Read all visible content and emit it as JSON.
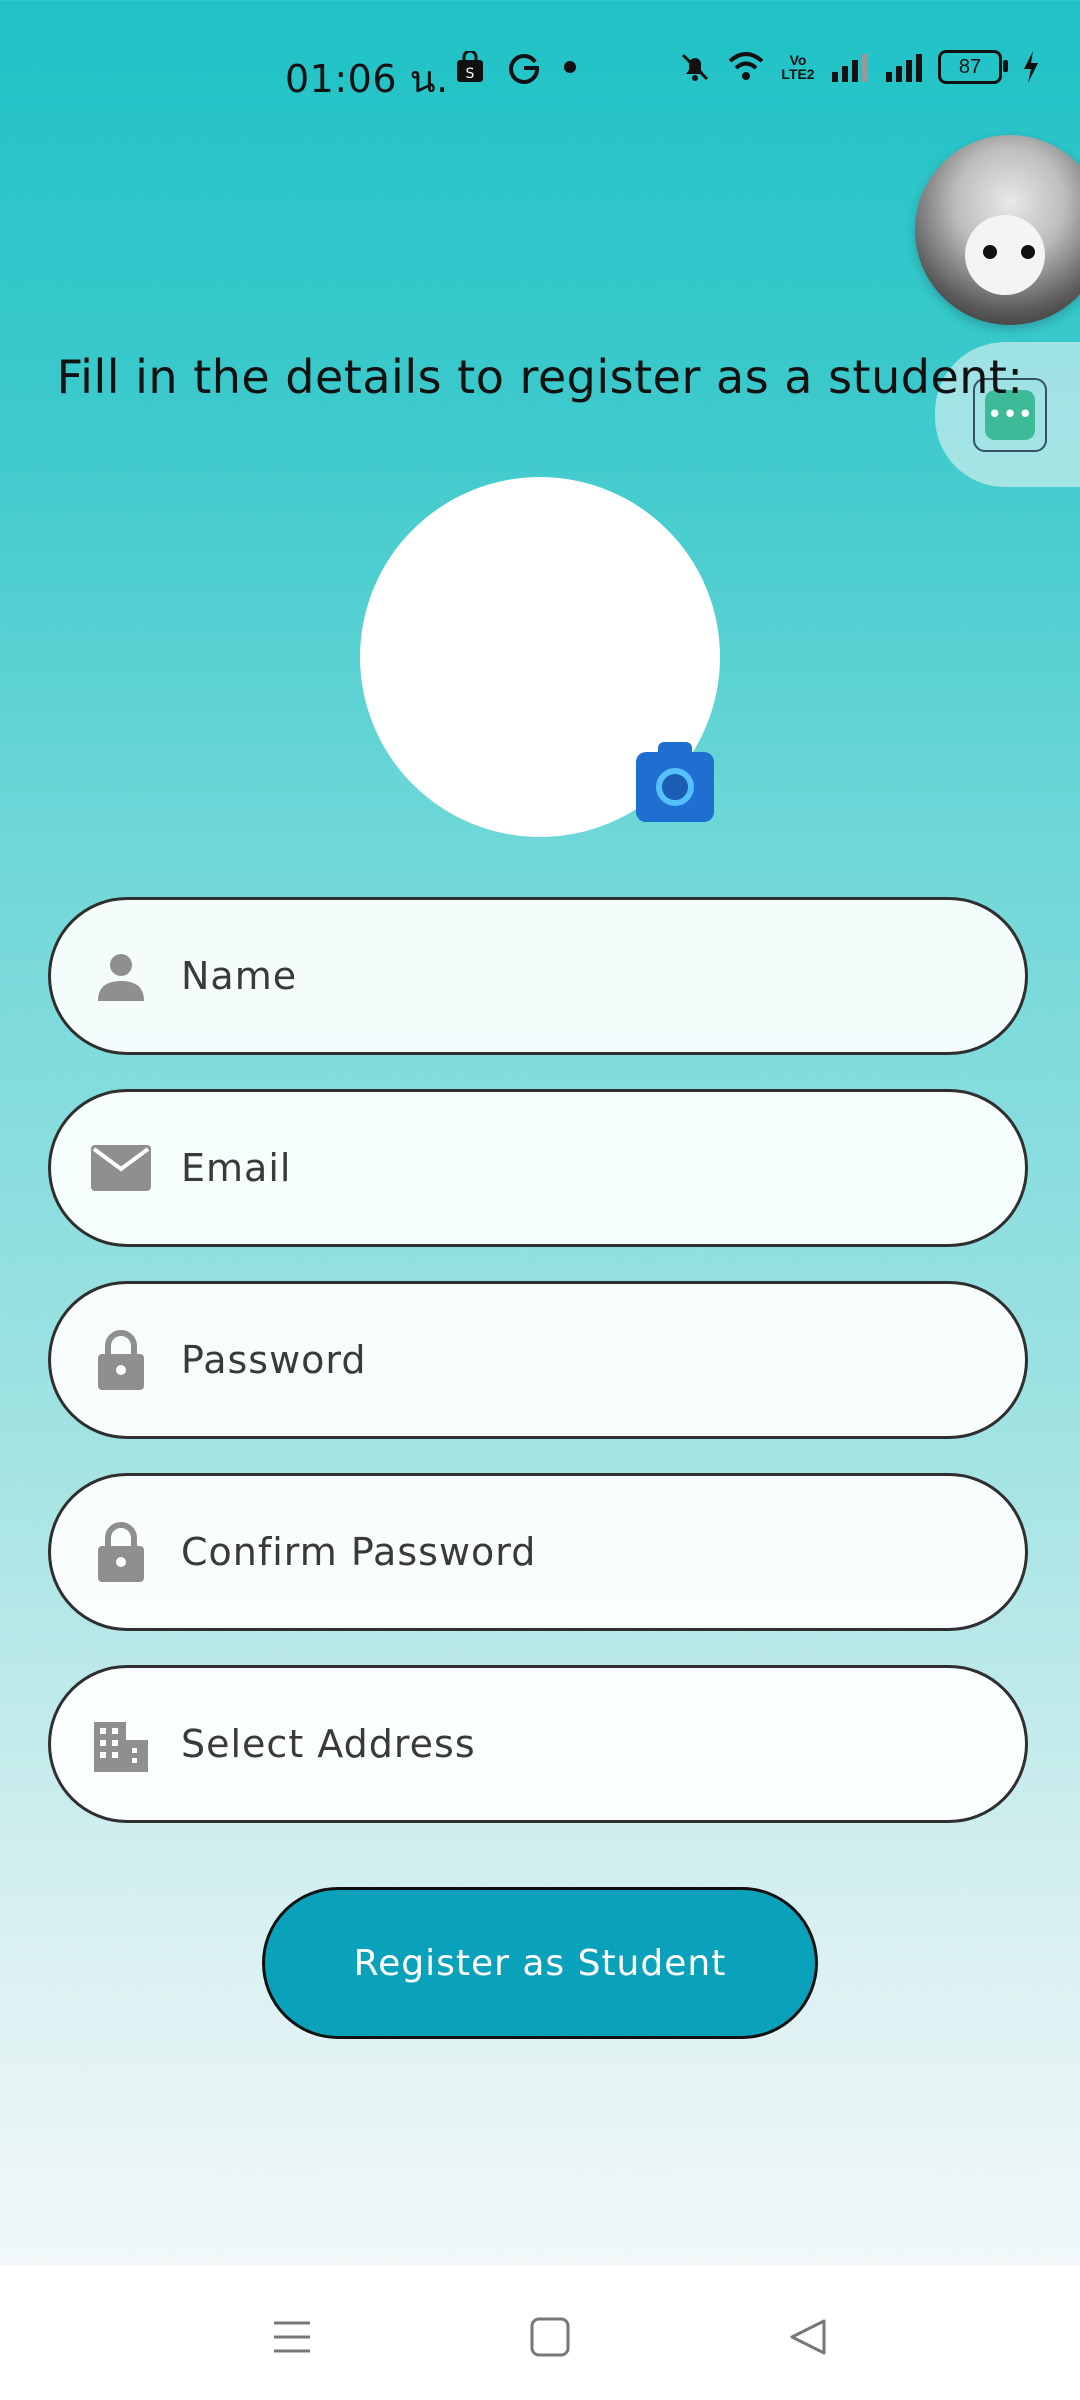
{
  "status_bar": {
    "time": "01:06 น.",
    "network_label": "Vo LTE2",
    "battery": "87"
  },
  "page": {
    "headline": "Fill in the details to register as a student:"
  },
  "form": {
    "fields": [
      {
        "label": "Name",
        "icon": "person-icon"
      },
      {
        "label": "Email",
        "icon": "mail-icon"
      },
      {
        "label": "Password",
        "icon": "lock-icon"
      },
      {
        "label": "Confirm Password",
        "icon": "lock-icon"
      },
      {
        "label": "Select Address",
        "icon": "building-icon"
      }
    ],
    "submit_label": "Register as Student"
  },
  "floating_widget": {
    "chat_icon": "chat-bubble-icon",
    "avatar_icon": "floating-avatar"
  },
  "colors": {
    "button": "#0aa1bb",
    "gradient_top": "#1fc2c6",
    "camera": "#1f6fd0"
  }
}
